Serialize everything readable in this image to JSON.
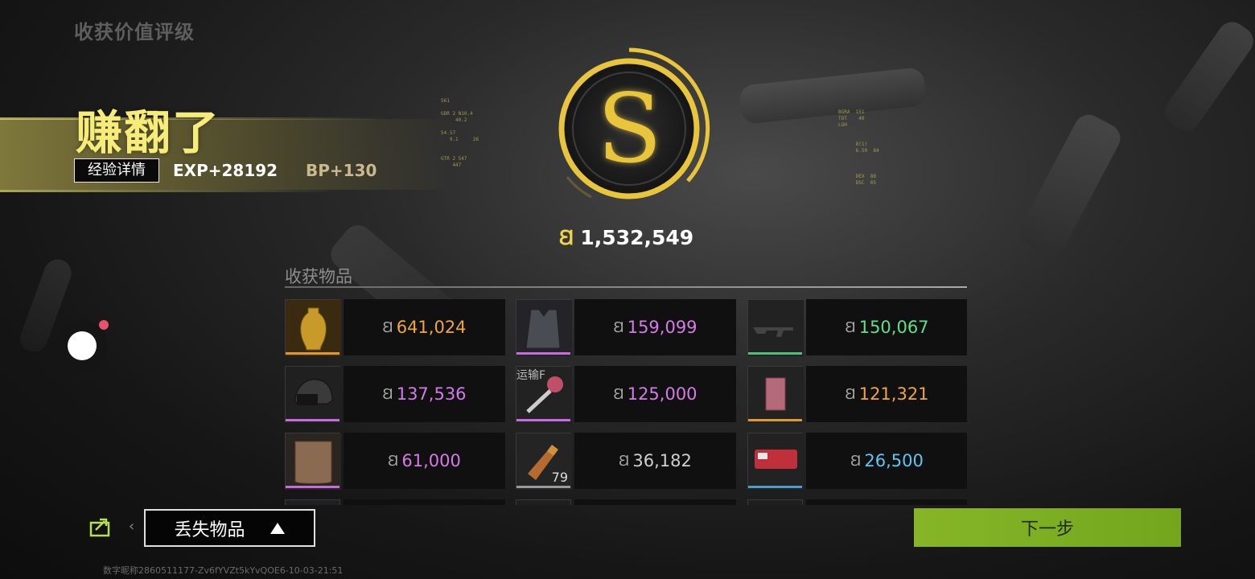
{
  "header": {
    "label": "收获价值评级"
  },
  "result": {
    "title": "赚翻了",
    "exp_button": "经验详情",
    "exp": "EXP+28192",
    "bp": "BP+130"
  },
  "rating": {
    "grade": "S",
    "total_value": "1,532,549",
    "coin_symbol": "Ꞛ"
  },
  "items_section": {
    "title": "收获物品"
  },
  "items": [
    {
      "name": "golden-vase",
      "value": "641,024",
      "color": "#f0a63a",
      "rarity_bar": "#e09a2a",
      "tag": "",
      "qty": ""
    },
    {
      "name": "tactical-vest",
      "value": "159,099",
      "color": "#d57ae8",
      "rarity_bar": "#c86ae0",
      "tag": "",
      "qty": ""
    },
    {
      "name": "rifle",
      "value": "150,067",
      "color": "#5fe08a",
      "rarity_bar": "#4fbf7a",
      "tag": "",
      "qty": ""
    },
    {
      "name": "helmet",
      "value": "137,536",
      "color": "#d57ae8",
      "rarity_bar": "#c86ae0",
      "tag": "",
      "qty": ""
    },
    {
      "name": "key",
      "value": "125,000",
      "color": "#d57ae8",
      "rarity_bar": "#c86ae0",
      "tag": "运输F",
      "qty": ""
    },
    {
      "name": "document",
      "value": "121,321",
      "color": "#f0a63a",
      "rarity_bar": "#e09a2a",
      "tag": "",
      "qty": ""
    },
    {
      "name": "armor-plate",
      "value": "61,000",
      "color": "#d57ae8",
      "rarity_bar": "#c86ae0",
      "tag": "",
      "qty": ""
    },
    {
      "name": "ammo",
      "value": "36,182",
      "color": "#cfcfcf",
      "rarity_bar": "#9a9a9a",
      "tag": "",
      "qty": "79"
    },
    {
      "name": "red-case",
      "value": "26,500",
      "color": "#5ec6f0",
      "rarity_bar": "#4a9fd0",
      "tag": "",
      "qty": ""
    }
  ],
  "footer": {
    "lost_items": "丢失物品",
    "next": "下一步",
    "id_text": "数字昵称2860511177-Zv6fYVZt5kYvQOE6-10-03-21:51"
  },
  "hud": {
    "left_1": "561\n\nGDR 2 N10.4\n     40.2\n\n54.57\n   9.1     26\n\n\nGTR 2 547\n    447",
    "right_1": "BGRA  151\nTOT    40\nLGH\n\n\n      8(1)\n      6.50  84\n\n\n\n      DEX  88\n      DSC  05"
  }
}
